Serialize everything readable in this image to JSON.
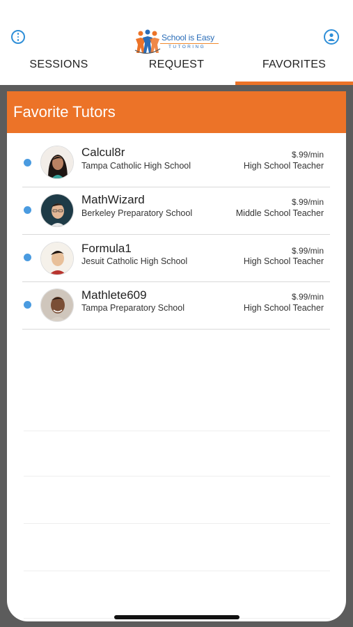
{
  "header": {
    "logo_text": "School is Easy",
    "logo_subtext": "TUTORING",
    "info_icon": "info-icon",
    "profile_icon": "profile-icon"
  },
  "tabs": [
    {
      "label": "SESSIONS",
      "active": false
    },
    {
      "label": "REQUEST",
      "active": false
    },
    {
      "label": "FAVORITES",
      "active": true
    }
  ],
  "panel": {
    "title": "Favorite Tutors"
  },
  "tutors": [
    {
      "name": "Calcul8r",
      "school": "Tampa Catholic High School",
      "rate": "$.99/min",
      "role": "High School Teacher"
    },
    {
      "name": "MathWizard",
      "school": "Berkeley Preparatory School",
      "rate": "$.99/min",
      "role": "Middle School Teacher"
    },
    {
      "name": "Formula1",
      "school": "Jesuit Catholic High School",
      "rate": "$.99/min",
      "role": "High School Teacher"
    },
    {
      "name": "Mathlete609",
      "school": "Tampa Preparatory School",
      "rate": "$.99/min",
      "role": "High School Teacher"
    }
  ],
  "colors": {
    "accent": "#ec7328",
    "link_blue": "#2f8fd8",
    "status_dot": "#4a9be0",
    "frame": "#5c5c5c"
  }
}
